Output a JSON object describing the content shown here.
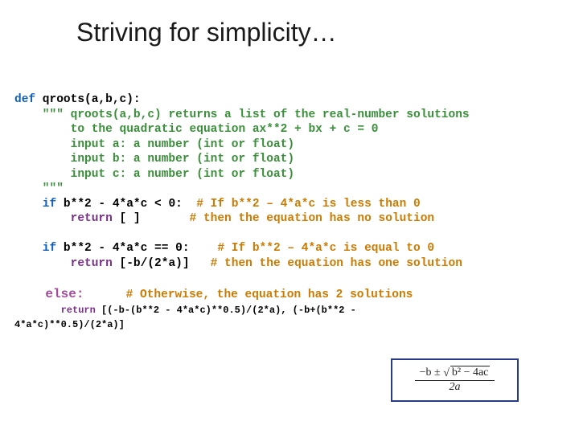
{
  "title": "Striving for simplicity…",
  "code": {
    "def_kw": "def",
    "sig": " qroots(a,b,c):",
    "doc_open": "    \"\"\"",
    "doc_l1": " qroots(a,b,c) returns a list of the real-number solutions",
    "doc_l2": "        to the quadratic equation ax**2 + bx + c = 0",
    "doc_l3": "        input a: a number (int or float)",
    "doc_l4": "        input b: a number (int or float)",
    "doc_l5": "        input c: a number (int or float)",
    "doc_close": "    \"\"\"",
    "if1_kw": "    if",
    "if1_cond": " b**2 - 4*a*c < 0:",
    "if1_c1": "  # If b**2 – 4*a*c is less than 0",
    "ret1_kw": "        return",
    "ret1_val": " [ ]",
    "ret1_c": "       # then the equation has no solution",
    "if2_kw": "    if",
    "if2_cond": " b**2 - 4*a*c == 0:",
    "if2_c1": "    # If b**2 – 4*a*c is equal to 0",
    "ret2_kw": "        return",
    "ret2_val": " [-b/(2*a)]",
    "ret2_c": "   # then the equation has one solution",
    "else_kw": "    else:",
    "else_c": "      # Otherwise, the equation has 2 solutions",
    "ret3_kw": "        return",
    "ret3_val": " [(-b-(b**2 - 4*a*c)**0.5)/(2*a), (-b+(b**2 - ",
    "ret3_cont": "4*a*c)**0.5)/(2*a)]"
  },
  "formula": {
    "numerator_prefix": "−b ± ",
    "radicand": "b² − 4ac",
    "denominator": "2a"
  }
}
